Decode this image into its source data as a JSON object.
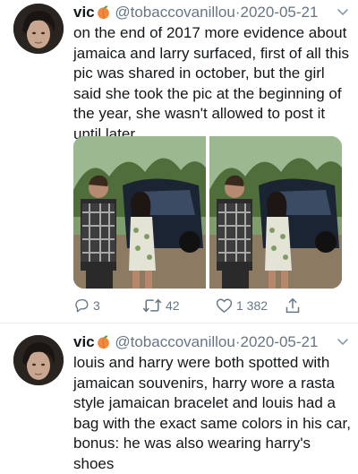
{
  "tweets": [
    {
      "name": "vic",
      "handle": "@tobaccovanillou",
      "separator": "·",
      "date": "2020-05-21",
      "lines": [
        "on the end of 2017 more evidence about",
        "jamaica and larry surfaced, first of all this",
        "pic was shared in october, but the girl",
        "said she took the pic at the beginning of",
        "the year, she wasn't allowed to post it",
        "until later"
      ],
      "actions": {
        "replies": "3",
        "retweets": "42",
        "likes": "1 382"
      }
    },
    {
      "name": "vic",
      "handle": "@tobaccovanillou",
      "separator": "·",
      "date": "2020-05-21",
      "lines": [
        "louis and harry were both spotted with",
        "jamaican souvenirs, harry wore a rasta",
        "style jamaican bracelet and louis had a",
        "bag with the exact same colors in his car,",
        "bonus: he was also wearing harry's shoes"
      ]
    }
  ],
  "icons": {
    "name_emoji": "peach-emoji-icon",
    "menu": "chevron-down-icon",
    "reply": "reply-icon",
    "retweet": "retweet-icon",
    "like": "heart-icon",
    "share": "share-icon"
  },
  "colors": {
    "text": "#14171a",
    "secondary": "#657786",
    "divider": "#e6ecf0",
    "peach": "#f4883a"
  }
}
